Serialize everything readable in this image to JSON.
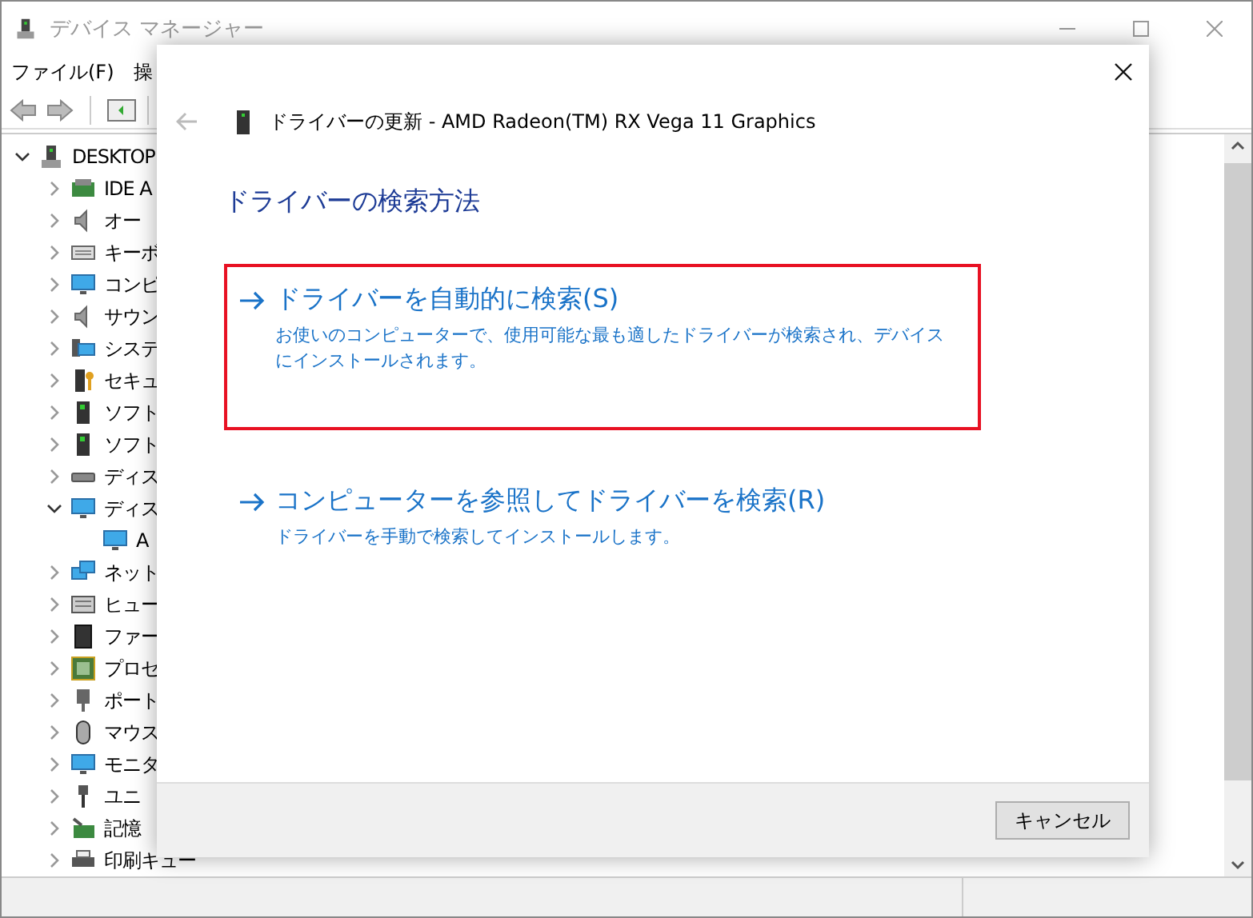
{
  "window": {
    "title": "デバイス マネージャー",
    "menu": [
      "ファイル(F)",
      "操"
    ],
    "tree": {
      "label": "DESKTOP",
      "expanded": true,
      "children": [
        {
          "label": "IDE A",
          "expanded": false
        },
        {
          "label": "オー",
          "expanded": false
        },
        {
          "label": "キーボ",
          "expanded": false
        },
        {
          "label": "コンピ",
          "expanded": false
        },
        {
          "label": "サウン",
          "expanded": false
        },
        {
          "label": "システ",
          "expanded": false
        },
        {
          "label": "セキュ",
          "expanded": false
        },
        {
          "label": "ソフト",
          "expanded": false
        },
        {
          "label": "ソフト",
          "expanded": false
        },
        {
          "label": "ディス",
          "expanded": false
        },
        {
          "label": "ディス",
          "expanded": true,
          "children": [
            {
              "label": "A"
            }
          ]
        },
        {
          "label": "ネット",
          "expanded": false
        },
        {
          "label": "ヒュー",
          "expanded": false
        },
        {
          "label": "ファー",
          "expanded": false
        },
        {
          "label": "プロセ",
          "expanded": false
        },
        {
          "label": "ポート",
          "expanded": false
        },
        {
          "label": "マウス",
          "expanded": false
        },
        {
          "label": "モニタ",
          "expanded": false
        },
        {
          "label": "ユニ",
          "expanded": false
        },
        {
          "label": "記憶",
          "expanded": false
        },
        {
          "label": "印刷キュー",
          "expanded": false
        }
      ]
    }
  },
  "dialog": {
    "header": "ドライバーの更新 - AMD Radeon(TM) RX Vega 11 Graphics",
    "heading": "ドライバーの検索方法",
    "options": [
      {
        "title": "ドライバーを自動的に検索(S)",
        "description": "お使いのコンピューターで、使用可能な最も適したドライバーが検索され、デバイスにインストールされます。",
        "selected": true
      },
      {
        "title": "コンピューターを参照してドライバーを検索(R)",
        "description": "ドライバーを手動で検索してインストールします。",
        "selected": false
      }
    ],
    "buttons": [
      "キャンセル"
    ]
  }
}
